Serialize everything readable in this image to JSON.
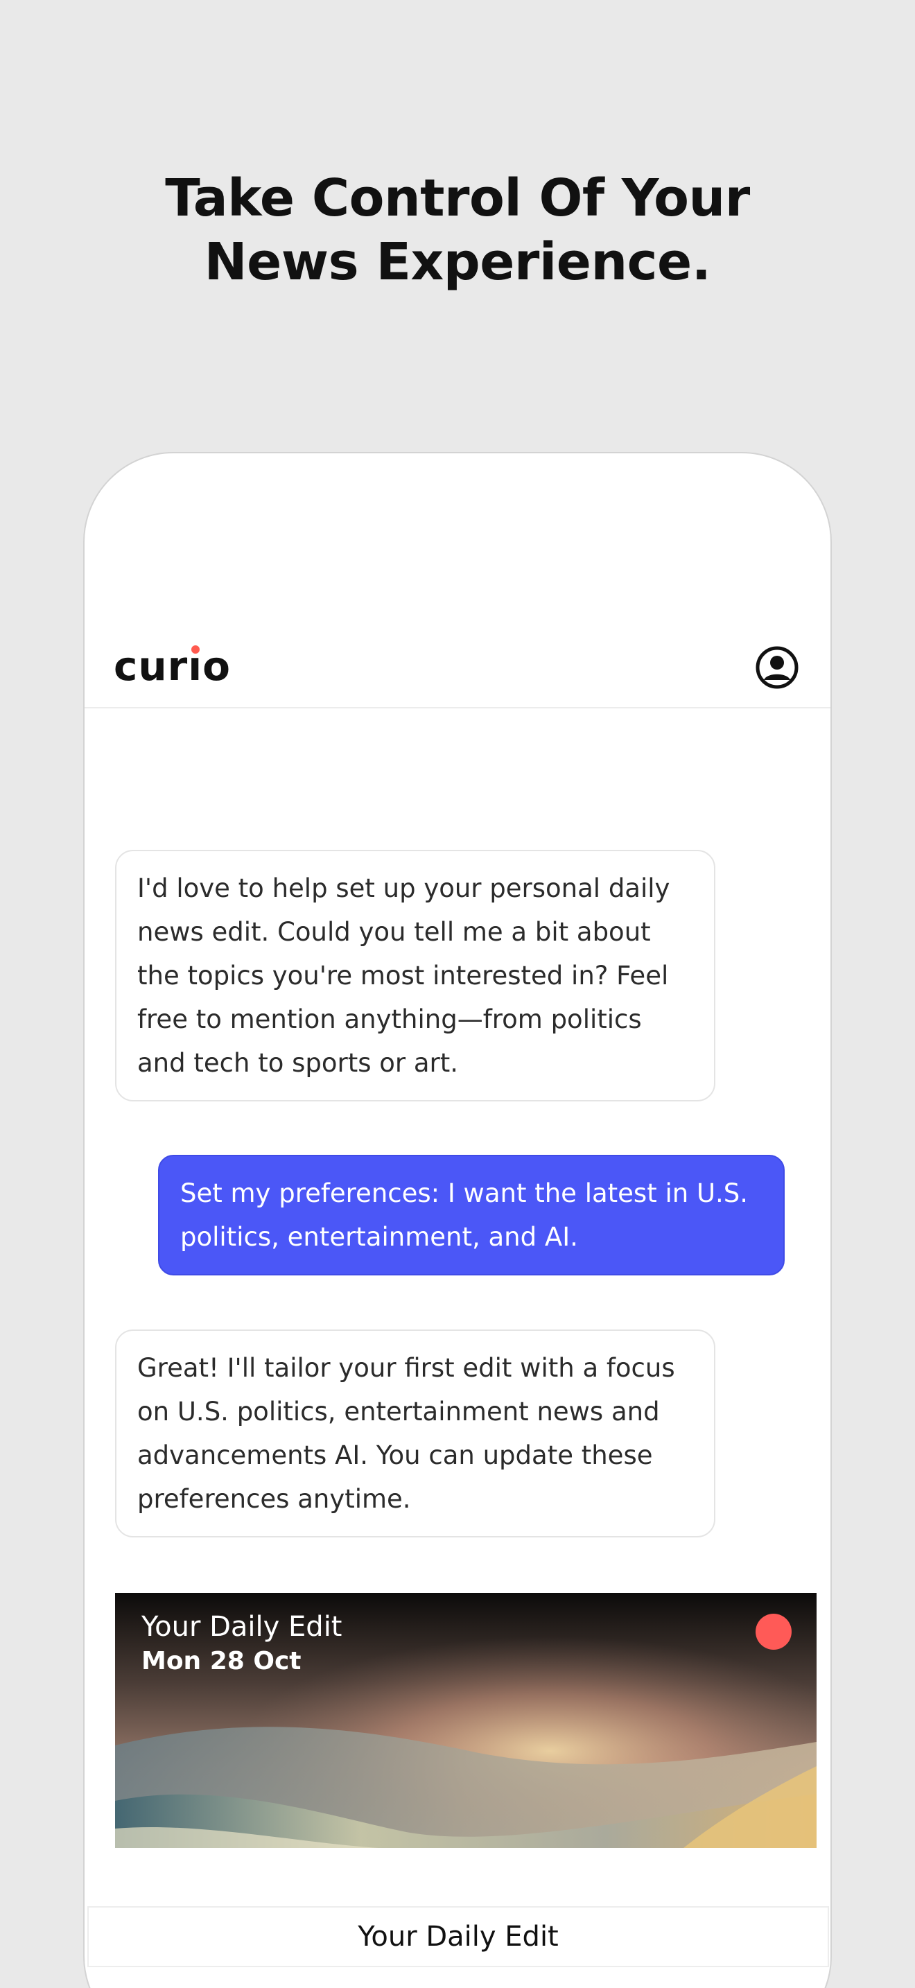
{
  "hero": {
    "line1": "Take Control Of Your",
    "line2": "News Experience."
  },
  "app": {
    "logo": "curio",
    "profile_icon": "profile-circle-icon"
  },
  "chat": {
    "messages": [
      {
        "role": "assistant",
        "text": "I'd love to help set up your personal daily news edit. Could you tell me a bit about the topics you're most interested in? Feel free to mention anything—from politics and tech to sports or art."
      },
      {
        "role": "user",
        "text": "Set my preferences: I want the latest in U.S. politics, entertainment, and AI."
      },
      {
        "role": "assistant",
        "text": "Great! I'll tailor your first edit with a focus on U.S. politics, entertainment news and advancements AI. You can update these preferences anytime."
      }
    ]
  },
  "edit_card": {
    "title": "Your Daily Edit",
    "date": "Mon 28 Oct",
    "status_color": "#ff5a57"
  },
  "bottom_tab": {
    "label": "Your Daily Edit"
  },
  "colors": {
    "background": "#e9e9e9",
    "user_bubble": "#4b57f7",
    "accent": "#ff5a4f"
  }
}
